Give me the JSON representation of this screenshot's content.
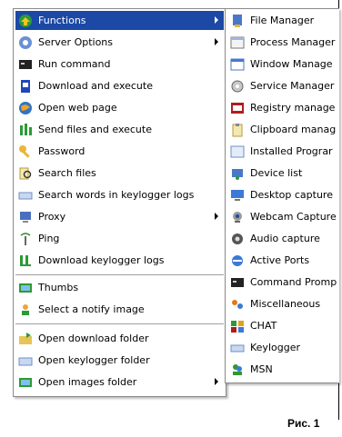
{
  "main_menu": {
    "items": [
      {
        "label": "Functions",
        "icon": "functions-icon",
        "submenu": true,
        "highlighted": true
      },
      {
        "label": "Server Options",
        "icon": "server-options-icon",
        "submenu": true
      },
      {
        "label": "Run command",
        "icon": "run-command-icon"
      },
      {
        "label": "Download and execute",
        "icon": "download-execute-icon"
      },
      {
        "label": "Open web page",
        "icon": "web-page-icon"
      },
      {
        "label": "Send files and execute",
        "icon": "send-files-icon"
      },
      {
        "label": "Password",
        "icon": "key-icon"
      },
      {
        "label": "Search files",
        "icon": "search-files-icon"
      },
      {
        "label": "Search words in keylogger logs",
        "icon": "search-logs-icon"
      },
      {
        "label": "Proxy",
        "icon": "proxy-icon",
        "submenu": true
      },
      {
        "label": "Ping",
        "icon": "ping-icon"
      },
      {
        "label": "Download keylogger logs",
        "icon": "download-logs-icon"
      },
      {
        "label": "Thumbs",
        "icon": "thumbs-icon"
      },
      {
        "label": "Select a notify image",
        "icon": "notify-image-icon"
      },
      {
        "label": "Open download folder",
        "icon": "download-folder-icon"
      },
      {
        "label": "Open keylogger folder",
        "icon": "keylogger-folder-icon"
      },
      {
        "label": "Open images folder",
        "icon": "images-folder-icon",
        "submenu": true
      }
    ]
  },
  "sub_menu": {
    "items": [
      {
        "label": "File Manager",
        "icon": "file-manager-icon"
      },
      {
        "label": "Process Manager",
        "icon": "process-manager-icon"
      },
      {
        "label": "Window Manage",
        "icon": "window-manager-icon"
      },
      {
        "label": "Service Manager",
        "icon": "service-manager-icon"
      },
      {
        "label": "Registry manage",
        "icon": "registry-icon"
      },
      {
        "label": "Clipboard manag",
        "icon": "clipboard-icon"
      },
      {
        "label": "Installed Prograr",
        "icon": "installed-programs-icon"
      },
      {
        "label": "Device list",
        "icon": "device-list-icon"
      },
      {
        "label": "Desktop capture",
        "icon": "desktop-capture-icon"
      },
      {
        "label": "Webcam Capture",
        "icon": "webcam-icon"
      },
      {
        "label": "Audio capture",
        "icon": "audio-icon"
      },
      {
        "label": "Active Ports",
        "icon": "ports-icon"
      },
      {
        "label": "Command Promp",
        "icon": "command-prompt-icon"
      },
      {
        "label": "Miscellaneous",
        "icon": "misc-icon"
      },
      {
        "label": "CHAT",
        "icon": "chat-icon"
      },
      {
        "label": "Keylogger",
        "icon": "keylogger-icon"
      },
      {
        "label": "MSN",
        "icon": "msn-icon"
      }
    ]
  },
  "caption": "Рис. 1",
  "colors": {
    "highlight": "#1c48a6"
  }
}
